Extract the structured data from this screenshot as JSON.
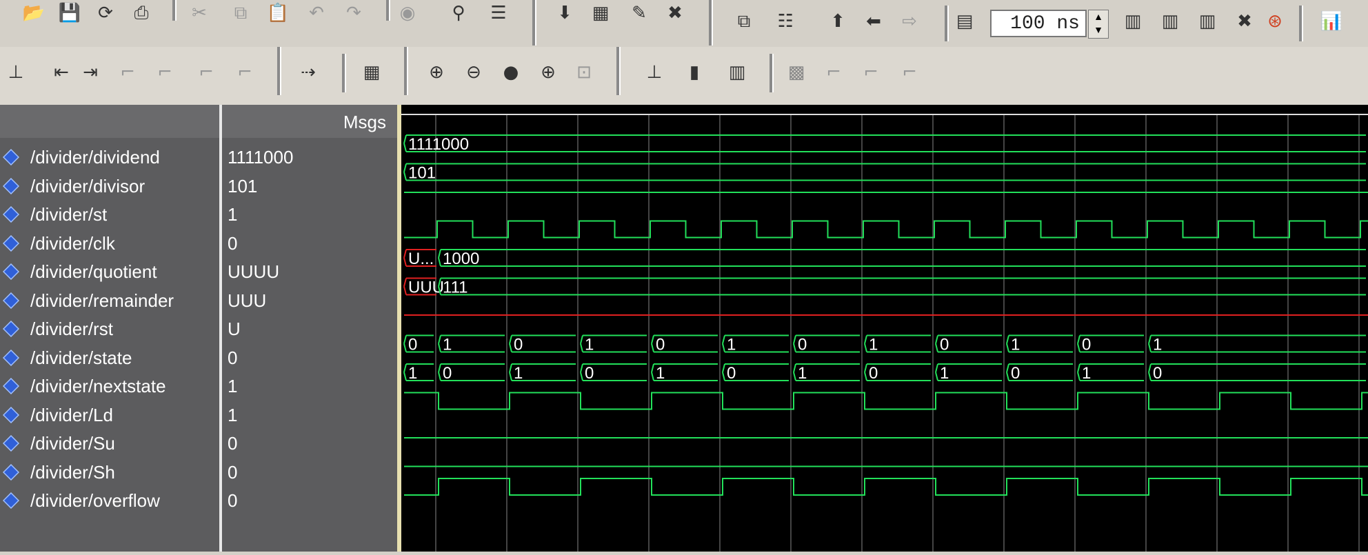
{
  "toolbar": {
    "time_value": "100 ns"
  },
  "panes": {
    "msgs_header": "Msgs"
  },
  "signals": [
    {
      "name": "/divider/dividend",
      "value": "1111000"
    },
    {
      "name": "/divider/divisor",
      "value": "101"
    },
    {
      "name": "/divider/st",
      "value": "1"
    },
    {
      "name": "/divider/clk",
      "value": "0"
    },
    {
      "name": "/divider/quotient",
      "value": "UUUU"
    },
    {
      "name": "/divider/remainder",
      "value": "UUU"
    },
    {
      "name": "/divider/rst",
      "value": "U"
    },
    {
      "name": "/divider/state",
      "value": "0"
    },
    {
      "name": "/divider/nextstate",
      "value": "1"
    },
    {
      "name": "/divider/Ld",
      "value": "1"
    },
    {
      "name": "/divider/Su",
      "value": "0"
    },
    {
      "name": "/divider/Sh",
      "value": "0"
    },
    {
      "name": "/divider/overflow",
      "value": "0"
    }
  ],
  "waveform_labels": {
    "dividend": "1111000",
    "divisor": "101",
    "quotient": [
      "U...",
      "1000"
    ],
    "remainder": [
      "UUU",
      "111"
    ],
    "state": [
      "0",
      "1",
      "0",
      "1",
      "0",
      "1",
      "0",
      "1",
      "0",
      "1",
      "0",
      "1"
    ],
    "nextstate": [
      "1",
      "0",
      "1",
      "0",
      "1",
      "0",
      "1",
      "0",
      "1",
      "0",
      "1",
      "0"
    ]
  },
  "colors": {
    "wave": "#22e05a",
    "undefined": "#e02020",
    "grid": "#5a5a5a",
    "background": "#000000"
  }
}
